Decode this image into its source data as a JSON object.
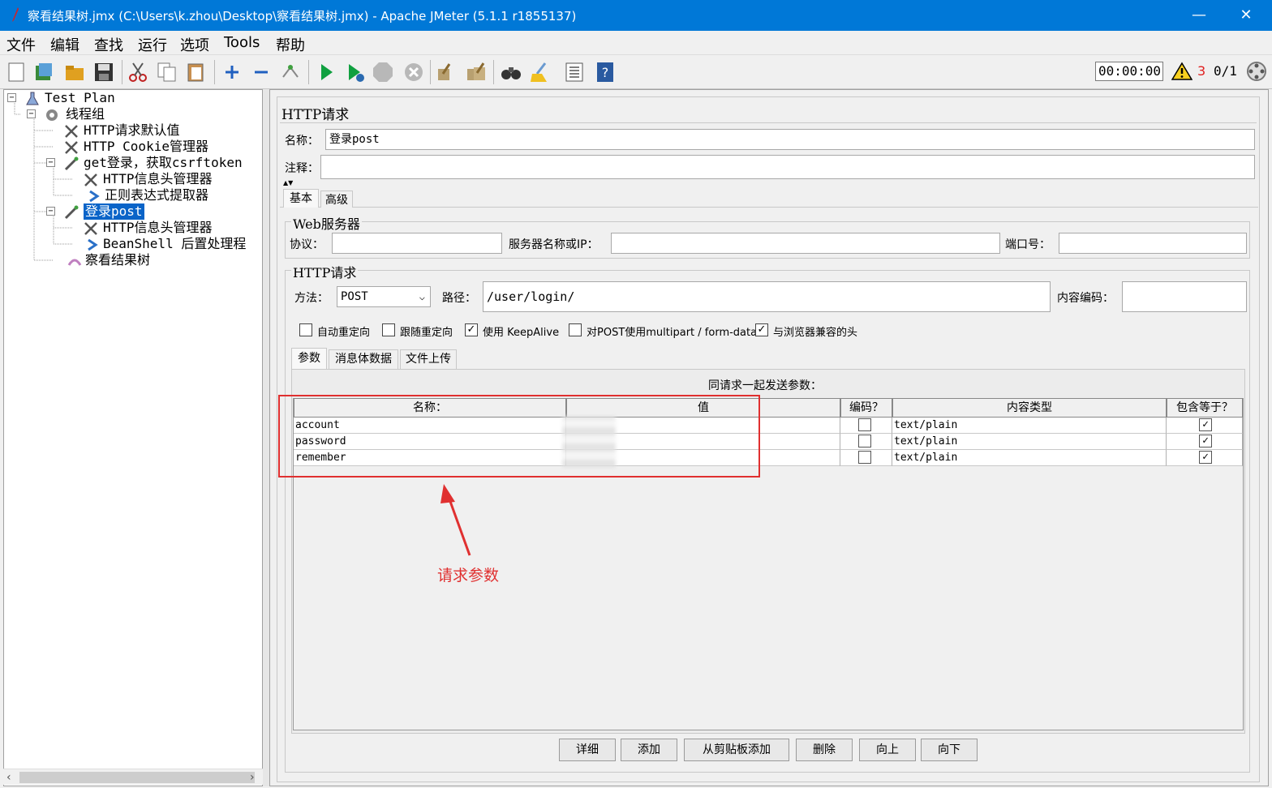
{
  "window": {
    "title": "察看结果树.jmx (C:\\Users\\k.zhou\\Desktop\\察看结果树.jmx) - Apache JMeter (5.1.1 r1855137)",
    "minimize": "—",
    "maximize": "☐",
    "close": "✕"
  },
  "menu": [
    "文件",
    "编辑",
    "查找",
    "运行",
    "选项",
    "Tools",
    "帮助"
  ],
  "toolbar": {
    "timer": "00:00:00",
    "warn_count": "3",
    "threads": "0/1"
  },
  "tree": [
    {
      "label": "Test Plan",
      "icon": "test-plan-icon"
    },
    {
      "label": "线程组",
      "icon": "gear-icon"
    },
    {
      "label": "HTTP请求默认值",
      "icon": "wrench-icon"
    },
    {
      "label": "HTTP Cookie管理器",
      "icon": "wrench-icon"
    },
    {
      "label": "get登录，获取csrftoken",
      "icon": "sampler-icon"
    },
    {
      "label": "HTTP信息头管理器",
      "icon": "wrench-icon"
    },
    {
      "label": "正则表达式提取器",
      "icon": "arrow-icon"
    },
    {
      "label": "登录post",
      "icon": "sampler-icon"
    },
    {
      "label": "HTTP信息头管理器",
      "icon": "wrench-icon"
    },
    {
      "label": "BeanShell 后置处理程",
      "icon": "arrow-icon"
    },
    {
      "label": "察看结果树",
      "icon": "listener-icon"
    }
  ],
  "panel": {
    "title": "HTTP请求",
    "name_label": "名称：",
    "name_value": "登录post",
    "comment_label": "注释：",
    "comment_value": "",
    "tabs": [
      "基本",
      "高级"
    ],
    "web_server": {
      "title": "Web服务器",
      "protocol_label": "协议：",
      "protocol_value": "",
      "server_label": "服务器名称或IP：",
      "server_value": "",
      "port_label": "端口号：",
      "port_value": ""
    },
    "http_request": {
      "title": "HTTP请求",
      "method_label": "方法：",
      "method_value": "POST",
      "path_label": "路径：",
      "path_value": "/user/login/",
      "encoding_label": "内容编码：",
      "encoding_value": ""
    },
    "checkboxes": [
      {
        "label": "自动重定向",
        "checked": false
      },
      {
        "label": "跟随重定向",
        "checked": false
      },
      {
        "label": "使用 KeepAlive",
        "checked": true
      },
      {
        "label": "对POST使用multipart / form-data",
        "checked": false
      },
      {
        "label": "与浏览器兼容的头",
        "checked": true
      }
    ],
    "subtabs": [
      "参数",
      "消息体数据",
      "文件上传"
    ],
    "params_caption": "同请求一起发送参数：",
    "columns": [
      "名称：",
      "值",
      "编码？",
      "内容类型",
      "包含等于？"
    ],
    "rows": [
      {
        "name": "account",
        "value": "",
        "encode": false,
        "type": "text/plain",
        "include_equals": true
      },
      {
        "name": "password",
        "value": "",
        "encode": false,
        "type": "text/plain",
        "include_equals": true
      },
      {
        "name": "remember",
        "value": "",
        "encode": false,
        "type": "text/plain",
        "include_equals": true
      }
    ],
    "buttons": [
      "详细",
      "添加",
      "从剪贴板添加",
      "删除",
      "向上",
      "向下"
    ]
  },
  "annotation": {
    "text": "请求参数",
    "color": "#e03030"
  },
  "colors": {
    "titlebar": "#0078d7",
    "selection": "#0a64c8"
  }
}
